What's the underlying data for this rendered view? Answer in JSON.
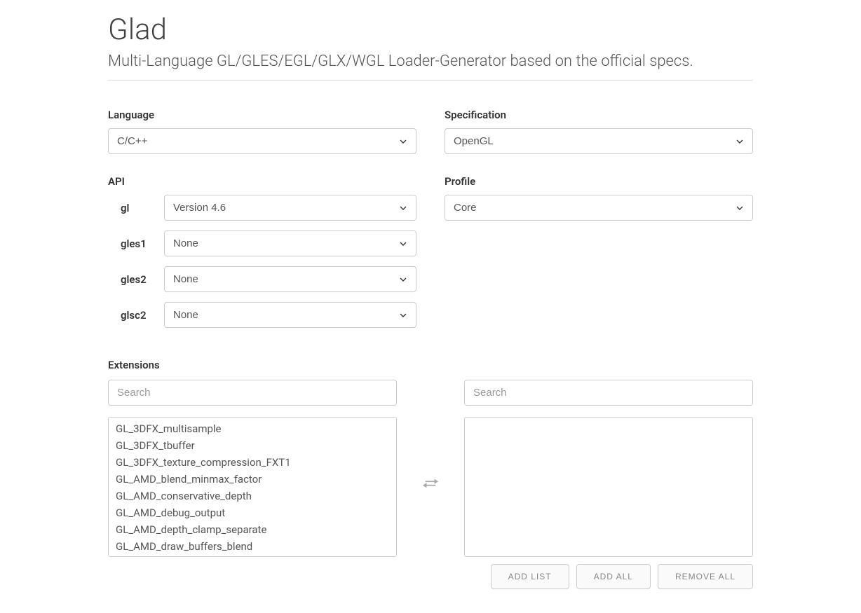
{
  "header": {
    "title": "Glad",
    "subtitle": "Multi-Language GL/GLES/EGL/GLX/WGL Loader-Generator based on the official specs."
  },
  "language": {
    "label": "Language",
    "value": "C/C++"
  },
  "specification": {
    "label": "Specification",
    "value": "OpenGL"
  },
  "api": {
    "label": "API",
    "items": [
      {
        "name": "gl",
        "value": "Version 4.6"
      },
      {
        "name": "gles1",
        "value": "None"
      },
      {
        "name": "gles2",
        "value": "None"
      },
      {
        "name": "glsc2",
        "value": "None"
      }
    ]
  },
  "profile": {
    "label": "Profile",
    "value": "Core"
  },
  "extensions": {
    "label": "Extensions",
    "search_placeholder_left": "Search",
    "search_placeholder_right": "Search",
    "available": [
      "GL_3DFX_multisample",
      "GL_3DFX_tbuffer",
      "GL_3DFX_texture_compression_FXT1",
      "GL_AMD_blend_minmax_factor",
      "GL_AMD_conservative_depth",
      "GL_AMD_debug_output",
      "GL_AMD_depth_clamp_separate",
      "GL_AMD_draw_buffers_blend"
    ],
    "buttons": {
      "add_list": "ADD LIST",
      "add_all": "ADD ALL",
      "remove_all": "REMOVE ALL"
    }
  }
}
